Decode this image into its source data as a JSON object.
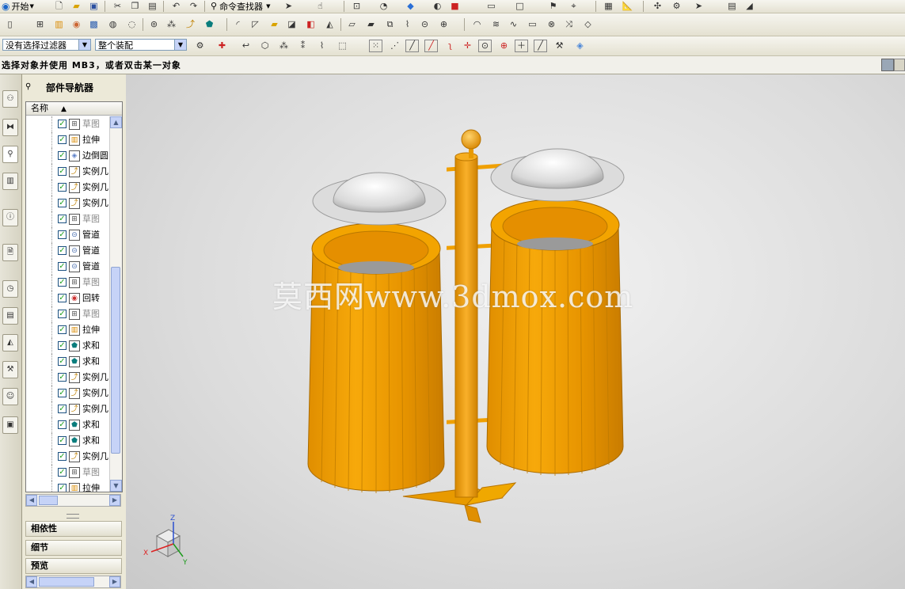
{
  "toolbar_row1": {
    "start_label": "开始",
    "command_finder_label": "命令查找器"
  },
  "toolbar_row3": {
    "filter_select": "没有选择过滤器",
    "scope_select": "整个装配"
  },
  "cue_line": {
    "text": "选择对象并使用 MB3，或者双击某一对象"
  },
  "navigator": {
    "title": "部件导航器",
    "column_header": "名称",
    "rows": [
      {
        "label": "草图",
        "icon": "sketch-icon",
        "dim": true
      },
      {
        "label": "拉伸",
        "icon": "extrude-icon",
        "dim": false
      },
      {
        "label": "边倒圆",
        "icon": "edge-blend-icon",
        "dim": false
      },
      {
        "label": "实例几何体",
        "icon": "instance-geometry-icon",
        "dim": false
      },
      {
        "label": "实例几何体",
        "icon": "instance-geometry-icon",
        "dim": false
      },
      {
        "label": "实例几何体",
        "icon": "instance-geometry-icon",
        "dim": false
      },
      {
        "label": "草图",
        "icon": "sketch-icon",
        "dim": true
      },
      {
        "label": "管道",
        "icon": "tube-icon",
        "dim": false
      },
      {
        "label": "管道",
        "icon": "tube-icon",
        "dim": false
      },
      {
        "label": "管道",
        "icon": "tube-icon",
        "dim": false
      },
      {
        "label": "草图",
        "icon": "sketch-icon",
        "dim": true
      },
      {
        "label": "回转",
        "icon": "revolve-icon",
        "dim": false
      },
      {
        "label": "草图",
        "icon": "sketch-icon",
        "dim": true
      },
      {
        "label": "拉伸",
        "icon": "extrude-icon",
        "dim": false
      },
      {
        "label": "求和",
        "icon": "unite-icon",
        "dim": false
      },
      {
        "label": "求和",
        "icon": "unite-icon",
        "dim": false
      },
      {
        "label": "实例几何体",
        "icon": "instance-geometry-icon",
        "dim": false
      },
      {
        "label": "实例几何体",
        "icon": "instance-geometry-icon",
        "dim": false
      },
      {
        "label": "实例几何体",
        "icon": "instance-geometry-icon",
        "dim": false
      },
      {
        "label": "求和",
        "icon": "unite-icon",
        "dim": false
      },
      {
        "label": "求和",
        "icon": "unite-icon",
        "dim": false
      },
      {
        "label": "实例几何体",
        "icon": "instance-geometry-icon",
        "dim": false
      },
      {
        "label": "草图",
        "icon": "sketch-icon",
        "dim": true
      },
      {
        "label": "拉伸",
        "icon": "extrude-icon",
        "dim": false
      }
    ],
    "panels": {
      "dependencies": "相依性",
      "details": "细节",
      "preview": "预览"
    }
  },
  "viewport": {
    "watermark": "莫西网www.3dmox.com",
    "axes": {
      "x": "X",
      "y": "Y",
      "z": "Z"
    }
  },
  "colors": {
    "model_orange": "#f0a000",
    "lid_grey": "#d8d8d8",
    "check_green": "#21a121",
    "scroll_blue": "#c6d3f7"
  }
}
